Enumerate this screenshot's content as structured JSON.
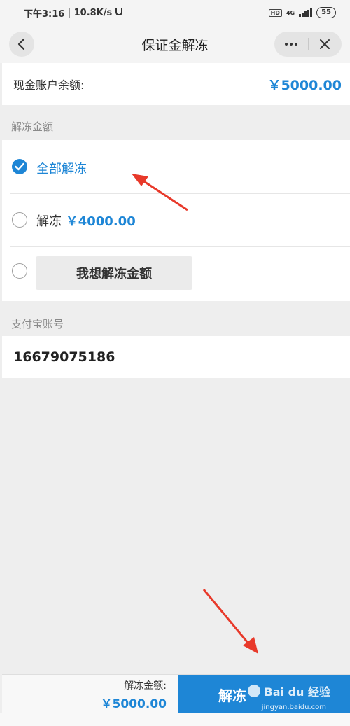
{
  "status_bar": {
    "time": "下午3:16",
    "speed": "| 10.8K/s",
    "hd": "HD",
    "network": "4G",
    "battery": "55"
  },
  "nav": {
    "title": "保证金解冻"
  },
  "balance": {
    "label": "现金账户余额:",
    "value": "￥5000.00"
  },
  "unfreeze_section": {
    "heading": "解冻金额",
    "options": [
      {
        "label": "全部解冻",
        "checked": true
      },
      {
        "label": "解冻",
        "amount": "￥4000.00",
        "checked": false
      },
      {
        "button_label": "我想解冻金额",
        "checked": false
      }
    ]
  },
  "alipay_section": {
    "heading": "支付宝账号",
    "account": "16679075186"
  },
  "bottom_bar": {
    "label": "解冻金额:",
    "amount": "￥5000.00",
    "submit_label": "解冻"
  },
  "watermark": {
    "brand": "Bai du 经验",
    "url": "jingyan.baidu.com"
  },
  "colors": {
    "accent": "#1e86d6",
    "annotation": "#e8392a"
  }
}
